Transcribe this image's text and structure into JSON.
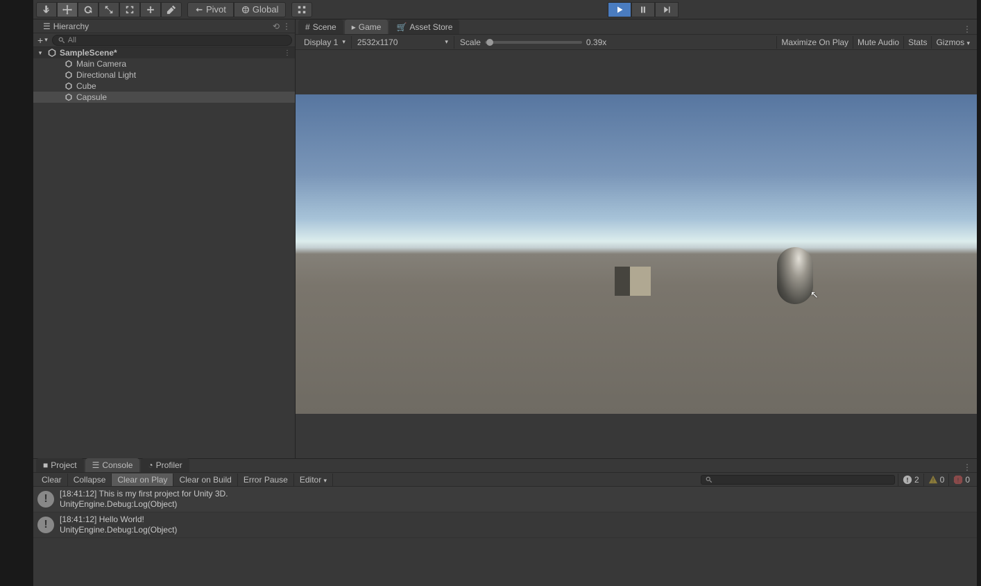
{
  "toolbar": {
    "pivot_label": "Pivot",
    "global_label": "Global",
    "playing": true
  },
  "hierarchy": {
    "title": "Hierarchy",
    "search_placeholder": "All",
    "scene_name": "SampleScene*",
    "items": [
      "Main Camera",
      "Directional Light",
      "Cube",
      "Capsule"
    ],
    "selected_index": 3
  },
  "tabs": {
    "scene": "Scene",
    "game": "Game",
    "asset_store": "Asset Store",
    "active": "game"
  },
  "game_toolbar": {
    "display": "Display 1",
    "resolution": "2532x1170",
    "scale_label": "Scale",
    "scale_value": "0.39x",
    "maximize": "Maximize On Play",
    "mute": "Mute Audio",
    "stats": "Stats",
    "gizmos": "Gizmos"
  },
  "bottom_tabs": {
    "project": "Project",
    "console": "Console",
    "profiler": "Profiler",
    "active": "console"
  },
  "console_toolbar": {
    "clear": "Clear",
    "collapse": "Collapse",
    "clear_on_play": "Clear on Play",
    "clear_on_build": "Clear on Build",
    "error_pause": "Error Pause",
    "editor": "Editor",
    "info_count": "2",
    "warn_count": "0",
    "error_count": "0"
  },
  "logs": [
    {
      "time": "[18:41:12]",
      "msg": "This is my first project for Unity 3D.",
      "source": "UnityEngine.Debug:Log(Object)"
    },
    {
      "time": "[18:41:12]",
      "msg": "Hello World!",
      "source": "UnityEngine.Debug:Log(Object)"
    }
  ]
}
